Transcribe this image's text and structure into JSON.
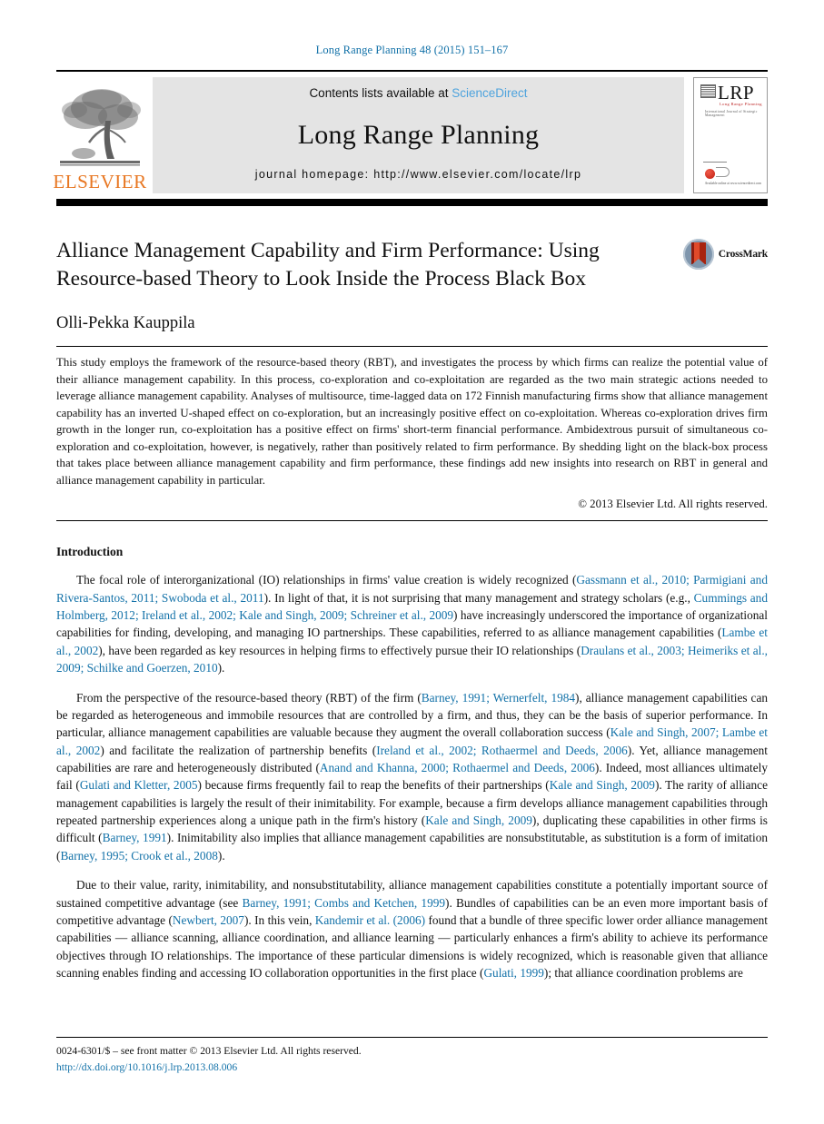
{
  "running_head": "Long Range Planning 48 (2015) 151–167",
  "masthead": {
    "publisher_wordmark": "ELSEVIER",
    "contents_prefix": "Contents lists available at ",
    "contents_link": "ScienceDirect",
    "journal_name": "Long Range Planning",
    "homepage": "journal homepage: http://www.elsevier.com/locate/lrp",
    "cover": {
      "title": "LRP",
      "subtitle": "Long Range Planning",
      "tagline": "International Journal of Strategic Management",
      "footer": "Available online at\nwww.sciencedirect.com"
    }
  },
  "article": {
    "title": "Alliance Management Capability and Firm Performance: Using Resource-based Theory to Look Inside the Process Black Box",
    "author": "Olli-Pekka Kauppila",
    "crossmark_label": "CrossMark",
    "abstract": "This study employs the framework of the resource-based theory (RBT), and investigates the process by which firms can realize the potential value of their alliance management capability. In this process, co-exploration and co-exploitation are regarded as the two main strategic actions needed to leverage alliance management capability. Analyses of multisource, time-lagged data on 172 Finnish manufacturing firms show that alliance management capability has an inverted U-shaped effect on co-exploration, but an increasingly positive effect on co-exploitation. Whereas co-exploration drives firm growth in the longer run, co-exploitation has a positive effect on firms' short-term financial performance. Ambidextrous pursuit of simultaneous co-exploration and co-exploitation, however, is negatively, rather than positively related to firm performance. By shedding light on the black-box process that takes place between alliance management capability and firm performance, these findings add new insights into research on RBT in general and alliance management capability in particular.",
    "copyright": "© 2013 Elsevier Ltd. All rights reserved."
  },
  "introduction": {
    "heading": "Introduction",
    "paragraphs": [
      [
        {
          "t": "The focal role of interorganizational (IO) relationships in firms' value creation is widely recognized ("
        },
        {
          "t": "Gassmann et al., 2010; Parmigiani and Rivera-Santos, 2011; Swoboda et al., 2011",
          "cite": true
        },
        {
          "t": "). In light of that, it is not surprising that many management and strategy scholars (e.g., "
        },
        {
          "t": "Cummings and Holmberg, 2012; Ireland et al., 2002; Kale and Singh, 2009; Schreiner et al., 2009",
          "cite": true
        },
        {
          "t": ") have increasingly underscored the importance of organizational capabilities for finding, developing, and managing IO partnerships. These capabilities, referred to as alliance management capabilities ("
        },
        {
          "t": "Lambe et al., 2002",
          "cite": true
        },
        {
          "t": "), have been regarded as key resources in helping firms to effectively pursue their IO relationships ("
        },
        {
          "t": "Draulans et al., 2003; Heimeriks et al., 2009; Schilke and Goerzen, 2010",
          "cite": true
        },
        {
          "t": ")."
        }
      ],
      [
        {
          "t": "From the perspective of the resource-based theory (RBT) of the firm ("
        },
        {
          "t": "Barney, 1991; Wernerfelt, 1984",
          "cite": true
        },
        {
          "t": "), alliance management capabilities can be regarded as heterogeneous and immobile resources that are controlled by a firm, and thus, they can be the basis of superior performance. In particular, alliance management capabilities are valuable because they augment the overall collaboration success ("
        },
        {
          "t": "Kale and Singh, 2007; Lambe et al., 2002",
          "cite": true
        },
        {
          "t": ") and facilitate the realization of partnership benefits ("
        },
        {
          "t": "Ireland et al., 2002; Rothaermel and Deeds, 2006",
          "cite": true
        },
        {
          "t": "). Yet, alliance management capabilities are rare and heterogeneously distributed ("
        },
        {
          "t": "Anand and Khanna, 2000; Rothaermel and Deeds, 2006",
          "cite": true
        },
        {
          "t": "). Indeed, most alliances ultimately fail ("
        },
        {
          "t": "Gulati and Kletter, 2005",
          "cite": true
        },
        {
          "t": ") because firms frequently fail to reap the benefits of their partnerships ("
        },
        {
          "t": "Kale and Singh, 2009",
          "cite": true
        },
        {
          "t": "). The rarity of alliance management capabilities is largely the result of their inimitability. For example, because a firm develops alliance management capabilities through repeated partnership experiences along a unique path in the firm's history ("
        },
        {
          "t": "Kale and Singh, 2009",
          "cite": true
        },
        {
          "t": "), duplicating these capabilities in other firms is difficult ("
        },
        {
          "t": "Barney, 1991",
          "cite": true
        },
        {
          "t": "). Inimitability also implies that alliance management capabilities are nonsubstitutable, as substitution is a form of imitation ("
        },
        {
          "t": "Barney, 1995; Crook et al., 2008",
          "cite": true
        },
        {
          "t": ")."
        }
      ],
      [
        {
          "t": "Due to their value, rarity, inimitability, and nonsubstitutability, alliance management capabilities constitute a potentially important source of sustained competitive advantage (see "
        },
        {
          "t": "Barney, 1991; Combs and Ketchen, 1999",
          "cite": true
        },
        {
          "t": "). Bundles of capabilities can be an even more important basis of competitive advantage ("
        },
        {
          "t": "Newbert, 2007",
          "cite": true
        },
        {
          "t": "). In this vein, "
        },
        {
          "t": "Kandemir et al. (2006)",
          "cite": true
        },
        {
          "t": " found that a bundle of three specific lower order alliance management capabilities — alliance scanning, alliance coordination, and alliance learning — particularly enhances a firm's ability to achieve its performance objectives through IO relationships. The importance of these particular dimensions is widely recognized, which is reasonable given that alliance scanning enables finding and accessing IO collaboration opportunities in the first place ("
        },
        {
          "t": "Gulati, 1999",
          "cite": true
        },
        {
          "t": "); that alliance coordination problems are"
        }
      ]
    ]
  },
  "footer": {
    "issn_line": "0024-6301/$ – see front matter © 2013 Elsevier Ltd. All rights reserved.",
    "doi": "http://dx.doi.org/10.1016/j.lrp.2013.08.006"
  },
  "colors": {
    "link": "#1271a8",
    "sciencedirect": "#4ea3dd",
    "elsevier_orange": "#e87722",
    "masthead_gray": "#e4e4e4"
  }
}
